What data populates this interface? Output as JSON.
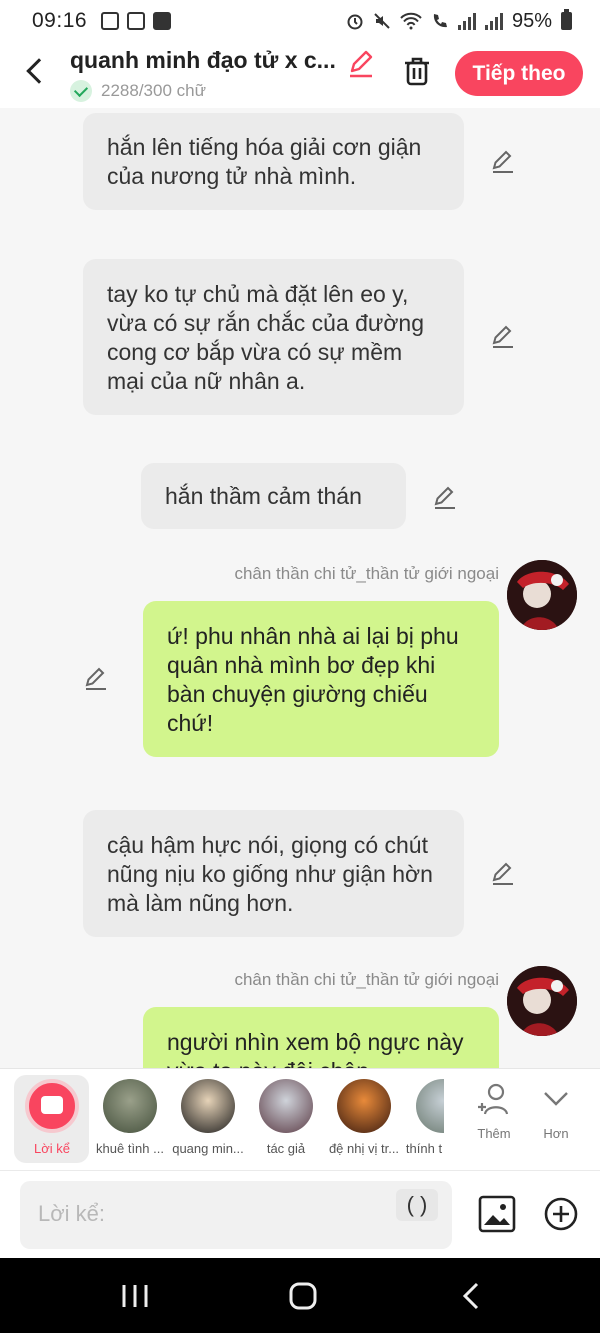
{
  "status_bar": {
    "time": "09:16",
    "battery": "95%"
  },
  "header": {
    "title": "quanh minh đạo tử x c...",
    "word_count": "2288/300 chữ",
    "next_label": "Tiếp theo"
  },
  "messages": [
    {
      "type": "narration",
      "text": "hắn lên tiếng hóa giải cơn giận của nương tử nhà mình."
    },
    {
      "type": "narration",
      "text": "tay ko tự chủ mà đặt lên eo y, vừa có sự rắn chắc của đường cong cơ bắp vừa có sự mềm mại của nữ nhân a."
    },
    {
      "type": "narration",
      "text": "hắn thầm cảm thán"
    },
    {
      "type": "character",
      "sender": "chân thần chi tử_thần tử giới ngoại",
      "text": "ứ! phu nhân nhà ai lại bị phu quân nhà mình bơ đẹp khi bàn chuyện giường chiếu chứ!"
    },
    {
      "type": "narration",
      "text": "cậu hậm hực nói, giọng có chút nũng nịu ko giống như giận hờn mà làm nũng hơn."
    },
    {
      "type": "character",
      "sender": "chân thần chi tử_thần tử giới ngoại",
      "text": "người nhìn xem bộ ngực này vừa to này đôi chân"
    }
  ],
  "characters": [
    {
      "label": "Lời kể",
      "active": true
    },
    {
      "label": "khuê tình ..."
    },
    {
      "label": "quang min..."
    },
    {
      "label": "tác giả"
    },
    {
      "label": "đệ nhị vị tr..."
    },
    {
      "label": "thính t"
    }
  ],
  "tools": {
    "add_label": "Thêm",
    "more_label": "Hơn"
  },
  "input": {
    "placeholder": "Lời kể:",
    "paren_label": "( )"
  },
  "colors": {
    "accent": "#f9455f",
    "user_bubble": "#d2f58d",
    "narration_bubble": "#ebebeb"
  }
}
